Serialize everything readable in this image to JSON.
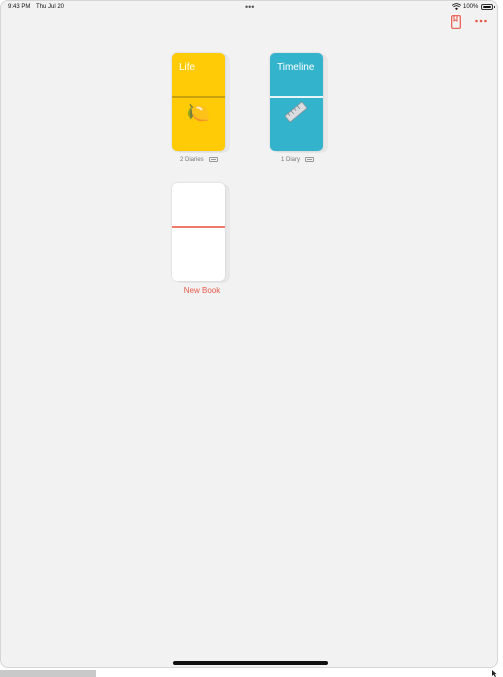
{
  "status_bar": {
    "time": "9:43 PM",
    "date": "Thu Jul 20",
    "multitask": "•••",
    "battery": "100%"
  },
  "toolbar": {
    "bookmark_icon": "bookmark-icon",
    "more_icon": "more-icon",
    "accent_color": "#e6594a"
  },
  "books": [
    {
      "title": "Life",
      "emoji": "🍋",
      "caption": "2 Diaries",
      "color": "#ffcb06"
    },
    {
      "title": "Timeline",
      "emoji": "📏",
      "caption": "1 Diary",
      "color": "#34b4cc"
    },
    {
      "title": "",
      "label": "New Book",
      "color": "#ffffff"
    }
  ]
}
